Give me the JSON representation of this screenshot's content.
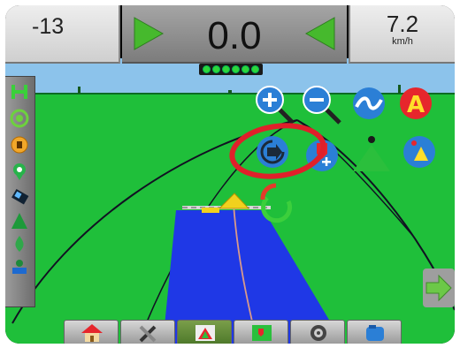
{
  "top_bar": {
    "heading_error": "-13",
    "cross_track": "0.0",
    "speed_value": "7.2",
    "speed_unit": "km/h"
  },
  "lightbar": {
    "leds_lit": 6
  },
  "left_toolbar": {
    "items": [
      "guidance-mode-icon",
      "boundary-icon",
      "marked-point-icon",
      "gps-status-icon",
      "tilt-icon",
      "section-icon",
      "flow-icon",
      "applied-area-icon"
    ]
  },
  "map_tools": {
    "zoom_in": "zoom-in-icon",
    "zoom_out": "zoom-out-icon",
    "guideline_mode": "guideline-mode-icon",
    "mark_a": "A",
    "nudge": "nudge-icon",
    "add_poi": "add-point-icon",
    "vehicle_view": "vehicle-view-icon",
    "bird_view": "birds-eye-view-icon"
  },
  "bottom_tabs": [
    "home-icon",
    "tools-icon",
    "vehicle-view-tab-icon",
    "map-tab-icon",
    "gauge-icon",
    "product-tank-icon"
  ],
  "colors": {
    "sky": "#8cc3eb",
    "field": "#1fbf3a",
    "applied_coverage": "#1f38e6",
    "highlight_ring": "#e0202a",
    "accent_green": "#2ec93c",
    "tool_blue": "#2b7fd6",
    "mark_a": "#e6262c"
  }
}
